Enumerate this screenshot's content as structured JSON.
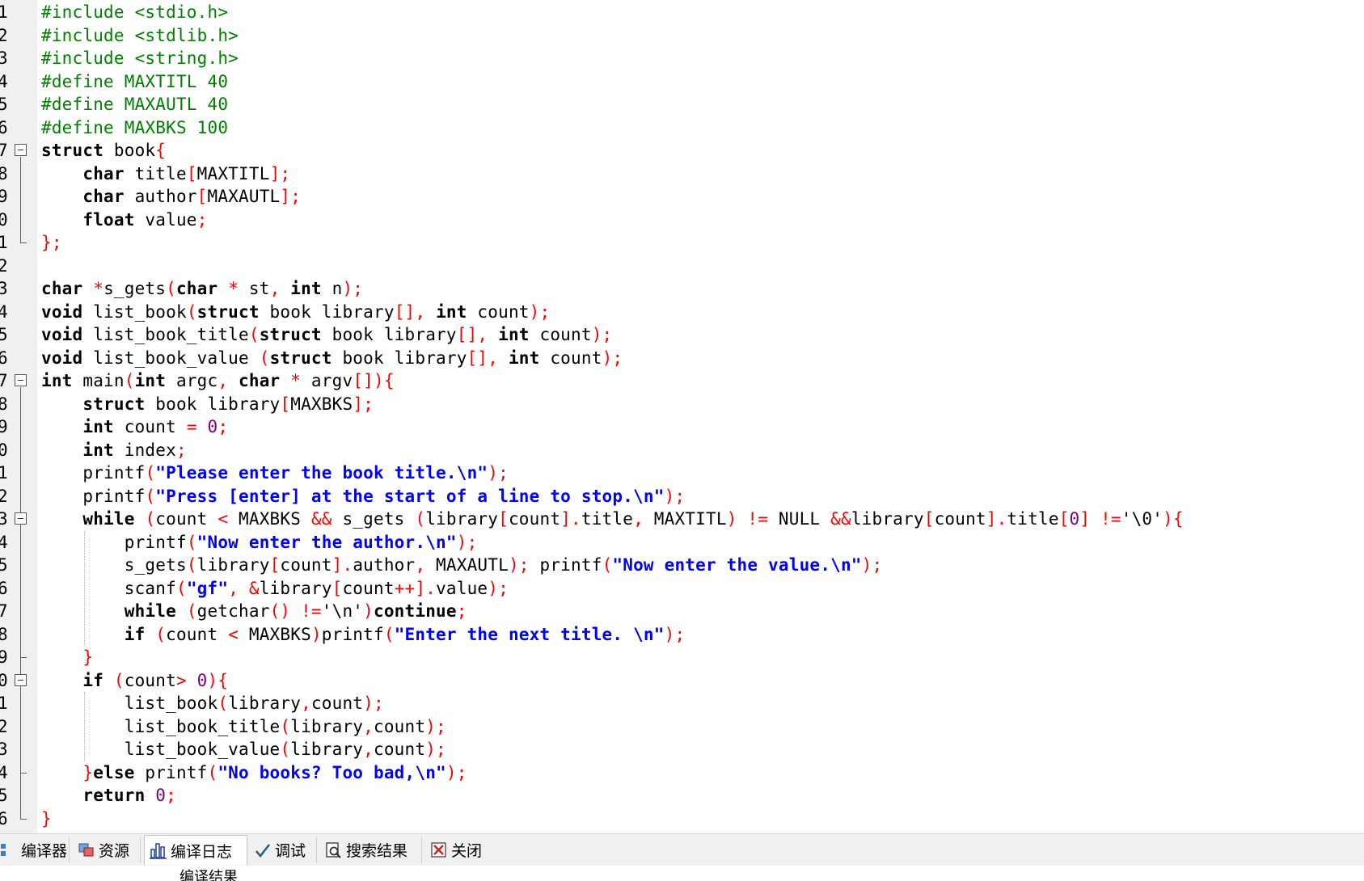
{
  "editor": {
    "lines": [
      {
        "num": "1",
        "tokens": [
          [
            "p",
            "#include <stdio.h>"
          ]
        ]
      },
      {
        "num": "2",
        "tokens": [
          [
            "p",
            "#include <stdlib.h>"
          ]
        ]
      },
      {
        "num": "3",
        "tokens": [
          [
            "p",
            "#include <string.h>"
          ]
        ]
      },
      {
        "num": "4",
        "tokens": [
          [
            "p",
            "#define MAXTITL 40"
          ]
        ]
      },
      {
        "num": "5",
        "tokens": [
          [
            "p",
            "#define MAXAUTL 40"
          ]
        ]
      },
      {
        "num": "6",
        "tokens": [
          [
            "p",
            "#define MAXBKS 100"
          ]
        ]
      },
      {
        "num": "7",
        "tokens": [
          [
            "k",
            "struct"
          ],
          [
            "c",
            " book"
          ],
          [
            "o",
            "{"
          ]
        ]
      },
      {
        "num": "8",
        "tokens": [
          [
            "c",
            "    "
          ],
          [
            "k",
            "char"
          ],
          [
            "c",
            " title"
          ],
          [
            "o",
            "["
          ],
          [
            "c",
            "MAXTITL"
          ],
          [
            "o",
            "];"
          ]
        ]
      },
      {
        "num": "9",
        "tokens": [
          [
            "c",
            "    "
          ],
          [
            "k",
            "char"
          ],
          [
            "c",
            " author"
          ],
          [
            "o",
            "["
          ],
          [
            "c",
            "MAXAUTL"
          ],
          [
            "o",
            "];"
          ]
        ]
      },
      {
        "num": "0",
        "tokens": [
          [
            "c",
            "    "
          ],
          [
            "k",
            "float"
          ],
          [
            "c",
            " value"
          ],
          [
            "o",
            ";"
          ]
        ]
      },
      {
        "num": "1",
        "tokens": [
          [
            "o",
            "};"
          ]
        ]
      },
      {
        "num": "2",
        "tokens": []
      },
      {
        "num": "3",
        "tokens": [
          [
            "k",
            "char"
          ],
          [
            "c",
            " "
          ],
          [
            "o",
            "*"
          ],
          [
            "c",
            "s_gets"
          ],
          [
            "o",
            "("
          ],
          [
            "k",
            "char"
          ],
          [
            "c",
            " "
          ],
          [
            "o",
            "*"
          ],
          [
            "c",
            " st"
          ],
          [
            "o",
            ","
          ],
          [
            "c",
            " "
          ],
          [
            "k",
            "int"
          ],
          [
            "c",
            " n"
          ],
          [
            "o",
            ");"
          ]
        ]
      },
      {
        "num": "4",
        "tokens": [
          [
            "k",
            "void"
          ],
          [
            "c",
            " list_book"
          ],
          [
            "o",
            "("
          ],
          [
            "k",
            "struct"
          ],
          [
            "c",
            " book library"
          ],
          [
            "o",
            "[],"
          ],
          [
            "c",
            " "
          ],
          [
            "k",
            "int"
          ],
          [
            "c",
            " count"
          ],
          [
            "o",
            ");"
          ]
        ]
      },
      {
        "num": "5",
        "tokens": [
          [
            "k",
            "void"
          ],
          [
            "c",
            " list_book_title"
          ],
          [
            "o",
            "("
          ],
          [
            "k",
            "struct"
          ],
          [
            "c",
            " book library"
          ],
          [
            "o",
            "[],"
          ],
          [
            "c",
            " "
          ],
          [
            "k",
            "int"
          ],
          [
            "c",
            " count"
          ],
          [
            "o",
            ");"
          ]
        ]
      },
      {
        "num": "6",
        "tokens": [
          [
            "k",
            "void"
          ],
          [
            "c",
            " list_book_value "
          ],
          [
            "o",
            "("
          ],
          [
            "k",
            "struct"
          ],
          [
            "c",
            " book library"
          ],
          [
            "o",
            "[],"
          ],
          [
            "c",
            " "
          ],
          [
            "k",
            "int"
          ],
          [
            "c",
            " count"
          ],
          [
            "o",
            ");"
          ]
        ]
      },
      {
        "num": "7",
        "tokens": [
          [
            "k",
            "int"
          ],
          [
            "c",
            " main"
          ],
          [
            "o",
            "("
          ],
          [
            "k",
            "int"
          ],
          [
            "c",
            " argc"
          ],
          [
            "o",
            ","
          ],
          [
            "c",
            " "
          ],
          [
            "k",
            "char"
          ],
          [
            "c",
            " "
          ],
          [
            "o",
            "*"
          ],
          [
            "c",
            " argv"
          ],
          [
            "o",
            "[]){"
          ]
        ]
      },
      {
        "num": "8",
        "tokens": [
          [
            "c",
            "    "
          ],
          [
            "k",
            "struct"
          ],
          [
            "c",
            " book library"
          ],
          [
            "o",
            "["
          ],
          [
            "c",
            "MAXBKS"
          ],
          [
            "o",
            "];"
          ]
        ]
      },
      {
        "num": "9",
        "tokens": [
          [
            "c",
            "    "
          ],
          [
            "k",
            "int"
          ],
          [
            "c",
            " count "
          ],
          [
            "o",
            "="
          ],
          [
            "c",
            " "
          ],
          [
            "n",
            "0"
          ],
          [
            "o",
            ";"
          ]
        ]
      },
      {
        "num": "0",
        "tokens": [
          [
            "c",
            "    "
          ],
          [
            "k",
            "int"
          ],
          [
            "c",
            " index"
          ],
          [
            "o",
            ";"
          ]
        ]
      },
      {
        "num": "1",
        "tokens": [
          [
            "c",
            "    printf"
          ],
          [
            "o",
            "("
          ],
          [
            "s",
            "\"Please enter the book title.\\n\""
          ],
          [
            "o",
            ");"
          ]
        ]
      },
      {
        "num": "2",
        "tokens": [
          [
            "c",
            "    printf"
          ],
          [
            "o",
            "("
          ],
          [
            "s",
            "\"Press [enter] at the start of a line to stop.\\n\""
          ],
          [
            "o",
            ");"
          ]
        ]
      },
      {
        "num": "3",
        "tokens": [
          [
            "c",
            "    "
          ],
          [
            "k",
            "while"
          ],
          [
            "c",
            " "
          ],
          [
            "o",
            "("
          ],
          [
            "c",
            "count "
          ],
          [
            "o",
            "<"
          ],
          [
            "c",
            " MAXBKS "
          ],
          [
            "o",
            "&&"
          ],
          [
            "c",
            " s_gets "
          ],
          [
            "o",
            "("
          ],
          [
            "c",
            "library"
          ],
          [
            "o",
            "["
          ],
          [
            "c",
            "count"
          ],
          [
            "o",
            "]."
          ],
          [
            "c",
            "title"
          ],
          [
            "o",
            ","
          ],
          [
            "c",
            " MAXTITL"
          ],
          [
            "o",
            ")"
          ],
          [
            "c",
            " "
          ],
          [
            "o",
            "!="
          ],
          [
            "c",
            " NULL "
          ],
          [
            "o",
            "&&"
          ],
          [
            "c",
            "library"
          ],
          [
            "o",
            "["
          ],
          [
            "c",
            "count"
          ],
          [
            "o",
            "]."
          ],
          [
            "c",
            "title"
          ],
          [
            "o",
            "["
          ],
          [
            "n",
            "0"
          ],
          [
            "o",
            "]"
          ],
          [
            "c",
            " "
          ],
          [
            "o",
            "!="
          ],
          [
            "c",
            "'\\0'"
          ],
          [
            "o",
            "){"
          ]
        ]
      },
      {
        "num": "4",
        "tokens": [
          [
            "c",
            "        printf"
          ],
          [
            "o",
            "("
          ],
          [
            "s",
            "\"Now enter the author.\\n\""
          ],
          [
            "o",
            ");"
          ]
        ]
      },
      {
        "num": "5",
        "tokens": [
          [
            "c",
            "        s_gets"
          ],
          [
            "o",
            "("
          ],
          [
            "c",
            "library"
          ],
          [
            "o",
            "["
          ],
          [
            "c",
            "count"
          ],
          [
            "o",
            "]."
          ],
          [
            "c",
            "author"
          ],
          [
            "o",
            ","
          ],
          [
            "c",
            " MAXAUTL"
          ],
          [
            "o",
            ");"
          ],
          [
            "c",
            " printf"
          ],
          [
            "o",
            "("
          ],
          [
            "s",
            "\"Now enter the value.\\n\""
          ],
          [
            "o",
            ");"
          ]
        ]
      },
      {
        "num": "6",
        "tokens": [
          [
            "c",
            "        scanf"
          ],
          [
            "o",
            "("
          ],
          [
            "s",
            "\"gf\""
          ],
          [
            "o",
            ","
          ],
          [
            "c",
            " "
          ],
          [
            "o",
            "&"
          ],
          [
            "c",
            "library"
          ],
          [
            "o",
            "["
          ],
          [
            "c",
            "count"
          ],
          [
            "o",
            "++]."
          ],
          [
            "c",
            "value"
          ],
          [
            "o",
            ");"
          ]
        ]
      },
      {
        "num": "7",
        "tokens": [
          [
            "c",
            "        "
          ],
          [
            "k",
            "while"
          ],
          [
            "c",
            " "
          ],
          [
            "o",
            "("
          ],
          [
            "c",
            "getchar"
          ],
          [
            "o",
            "()"
          ],
          [
            "c",
            " "
          ],
          [
            "o",
            "!="
          ],
          [
            "c",
            "'\\n'"
          ],
          [
            "o",
            ")"
          ],
          [
            "k",
            "continue"
          ],
          [
            "o",
            ";"
          ]
        ]
      },
      {
        "num": "8",
        "tokens": [
          [
            "c",
            "        "
          ],
          [
            "k",
            "if"
          ],
          [
            "c",
            " "
          ],
          [
            "o",
            "("
          ],
          [
            "c",
            "count "
          ],
          [
            "o",
            "<"
          ],
          [
            "c",
            " MAXBKS"
          ],
          [
            "o",
            ")"
          ],
          [
            "c",
            "printf"
          ],
          [
            "o",
            "("
          ],
          [
            "s",
            "\"Enter the next title. \\n\""
          ],
          [
            "o",
            ");"
          ]
        ]
      },
      {
        "num": "9",
        "tokens": [
          [
            "c",
            "    "
          ],
          [
            "o",
            "}"
          ]
        ]
      },
      {
        "num": "0",
        "tokens": [
          [
            "c",
            "    "
          ],
          [
            "k",
            "if"
          ],
          [
            "c",
            " "
          ],
          [
            "o",
            "("
          ],
          [
            "c",
            "count"
          ],
          [
            "o",
            ">"
          ],
          [
            "c",
            " "
          ],
          [
            "n",
            "0"
          ],
          [
            "o",
            "){"
          ]
        ]
      },
      {
        "num": "1",
        "tokens": [
          [
            "c",
            "        list_book"
          ],
          [
            "o",
            "("
          ],
          [
            "c",
            "library"
          ],
          [
            "o",
            ","
          ],
          [
            "c",
            "count"
          ],
          [
            "o",
            ");"
          ]
        ]
      },
      {
        "num": "2",
        "tokens": [
          [
            "c",
            "        list_book_title"
          ],
          [
            "o",
            "("
          ],
          [
            "c",
            "library"
          ],
          [
            "o",
            ","
          ],
          [
            "c",
            "count"
          ],
          [
            "o",
            ");"
          ]
        ]
      },
      {
        "num": "3",
        "tokens": [
          [
            "c",
            "        list_book_value"
          ],
          [
            "o",
            "("
          ],
          [
            "c",
            "library"
          ],
          [
            "o",
            ","
          ],
          [
            "c",
            "count"
          ],
          [
            "o",
            ");"
          ]
        ]
      },
      {
        "num": "4",
        "tokens": [
          [
            "c",
            "    "
          ],
          [
            "o",
            "}"
          ],
          [
            "k",
            "else"
          ],
          [
            "c",
            " printf"
          ],
          [
            "o",
            "("
          ],
          [
            "s",
            "\"No books? Too bad,\\n\""
          ],
          [
            "o",
            ");"
          ]
        ]
      },
      {
        "num": "5",
        "tokens": [
          [
            "c",
            "    "
          ],
          [
            "k",
            "return"
          ],
          [
            "c",
            " "
          ],
          [
            "n",
            "0"
          ],
          [
            "o",
            ";"
          ]
        ]
      },
      {
        "num": "6",
        "tokens": [
          [
            "o",
            "}"
          ]
        ]
      }
    ]
  },
  "bottom_tabs": {
    "items": [
      {
        "label": "编译器",
        "icon": "compiler-icon"
      },
      {
        "label": "资源",
        "icon": "resources-icon"
      },
      {
        "label": "编译日志",
        "icon": "compile-log-icon"
      },
      {
        "label": "调试",
        "icon": "debug-icon"
      },
      {
        "label": "搜索结果",
        "icon": "search-results-icon"
      },
      {
        "label": "关闭",
        "icon": "close-icon"
      }
    ],
    "active_index": 2
  },
  "status": {
    "compile_result": "编译结果"
  },
  "colors": {
    "preprocessor": "#008000",
    "keyword": "#000000",
    "string": "#0000ff",
    "operator": "#ff0000",
    "number": "#800080",
    "gutter_bg": "#f0f0f0",
    "tabbar_bg": "#f0f0f0"
  }
}
